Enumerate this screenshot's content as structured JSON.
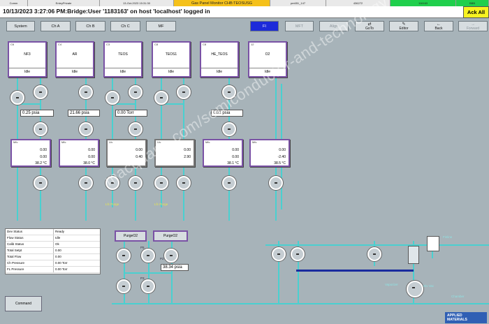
{
  "topbar": {
    "cells": [
      "Comm",
      "EnteyPrivate",
      "13-Oct-2023 15:31:30",
      "Gas Panel Monitor CHB:TEOSUSG",
      "pm651_147",
      "436272",
      "116163",
      "BBB"
    ]
  },
  "title": "10/13/2023 3:27:06 PM:Bridge:User '1183163' on host 'localhost' logged in",
  "ack_all": "Ack All",
  "toolbar": {
    "system": "System",
    "cha": "Ch A",
    "chb": "Ch B",
    "chc": "Ch C",
    "mf": "MF",
    "fi": "FI",
    "mft": "MFT",
    "align": "Align",
    "goto": "GoTo",
    "editor": "Editor",
    "back": "Back",
    "forward": "Forward"
  },
  "devices": [
    {
      "id": "C6",
      "name": "NF3",
      "status": "Idle"
    },
    {
      "id": "C4",
      "name": "AR",
      "status": "Idle"
    },
    {
      "id": "C3",
      "name": "TEOS",
      "status": "Idle"
    },
    {
      "id": "C8",
      "name": "TEOS1",
      "status": "Idle"
    },
    {
      "id": "C8",
      "name": "HE_TEOS",
      "status": "Idle"
    },
    {
      "id": "12",
      "name": "O2",
      "status": "Idle"
    }
  ],
  "readouts": {
    "nf3": "0.25 psia",
    "ar": "21.66 psia",
    "teos": "0.00 Torr",
    "he": "0.01 psia",
    "p2": "38.34 psia"
  },
  "mfcs": [
    {
      "id": "Mfc",
      "v1": "0.00",
      "v2": "0.00",
      "v3": "38.2 °C"
    },
    {
      "id": "Mfc",
      "v1": "0.00",
      "v2": "0.00",
      "v3": "38.0 °C"
    },
    {
      "id": "Lfc",
      "v1": "0.00",
      "v2": "0.40",
      "v3": ""
    },
    {
      "id": "Lfc",
      "v1": "0.00",
      "v2": "2.90",
      "v3": ""
    },
    {
      "id": "Mfc",
      "v1": "0.00",
      "v2": "0.00",
      "v3": "38.1 °C"
    },
    {
      "id": "Mfc",
      "v1": "0.00",
      "v2": "-2.40",
      "v3": "38.5 °C"
    }
  ],
  "labels": {
    "lfc_purge1": "Lfc Purge",
    "lfc_purge2": "Lfc Purge",
    "finis": "Finline",
    "vaporize": "Vaporizer",
    "divi": "Div Vac",
    "chamber": "Chamber",
    "p5": "P5",
    "p2": "P2",
    "p3": "P3"
  },
  "status": [
    {
      "k": "Dev Status",
      "v": "Ready"
    },
    {
      "k": "Flow Status",
      "v": "Idle"
    },
    {
      "k": "Calib Status",
      "v": "Ok"
    },
    {
      "k": "Total Setpt",
      "v": "0.00"
    },
    {
      "k": "Total Flow",
      "v": "0.00"
    },
    {
      "k": "Ch Pressure",
      "v": "0.00 Torr"
    },
    {
      "k": "FL Pressure",
      "v": "0.00 Torr"
    }
  ],
  "command": "Command",
  "purge_buttons": {
    "purge02": "PurgeO2",
    "purgeo2_2": "PurgeO2"
  },
  "watermark": "macquarie.com/semiconductor-and-technology",
  "logo": {
    "line1": "APPLIED",
    "line2": "MATERIALS"
  }
}
